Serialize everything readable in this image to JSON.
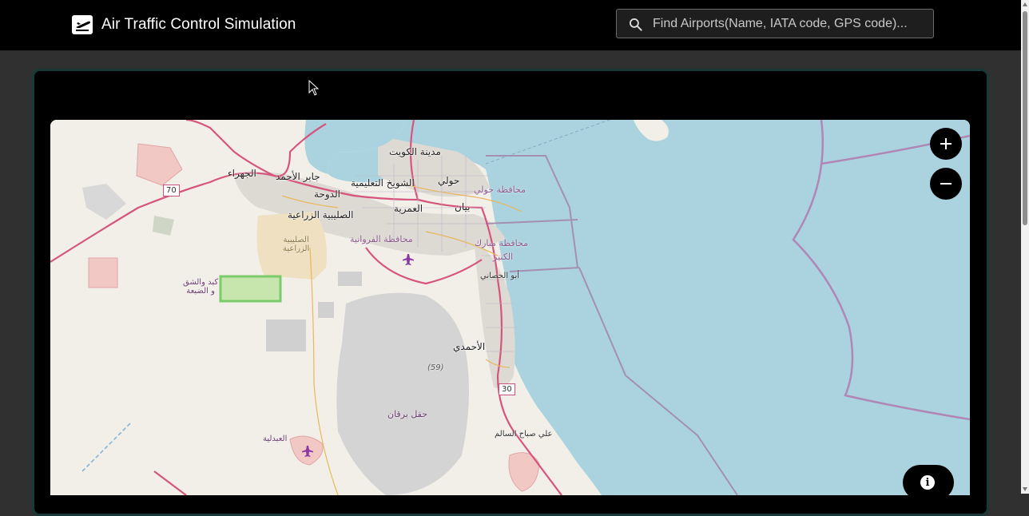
{
  "header": {
    "title": "Air Traffic Control Simulation",
    "search": {
      "placeholder": "Find Airports(Name, IATA code, GPS code)...",
      "value": ""
    }
  },
  "map": {
    "zoom_in_label": "+",
    "zoom_out_label": "−",
    "info_label": "i",
    "labels": {
      "kuwait_city": "مدينة الكويت",
      "jahra": "الجهراء",
      "jaber": "جابر الأحمد",
      "shuwaikh": "الشويخ التعليمية",
      "hawalli": "حولي",
      "hawalli_gov": "محافظة حولي",
      "doha": "الدوحة",
      "sulaibiya": "الصليبية الزراعية",
      "sulaibiya_farm": "الصليبية\nالزراعية",
      "omariya": "العمرية",
      "bayan": "بيان",
      "farwaniya": "محافظة الفروانية",
      "mubarak": "محافظة مبارك",
      "kabeer": "الكبير",
      "abu_halifa": "أبو الحصاني",
      "ahmadi": "الأحمدي",
      "kabd": "كبد والشق\nو الضبعة",
      "burgan": "حقل برقان",
      "abdali": "العبدلية",
      "sabah_salem": "علي صباح السالم",
      "road_70": "70",
      "road_30": "30",
      "road_59": "(59)"
    }
  }
}
